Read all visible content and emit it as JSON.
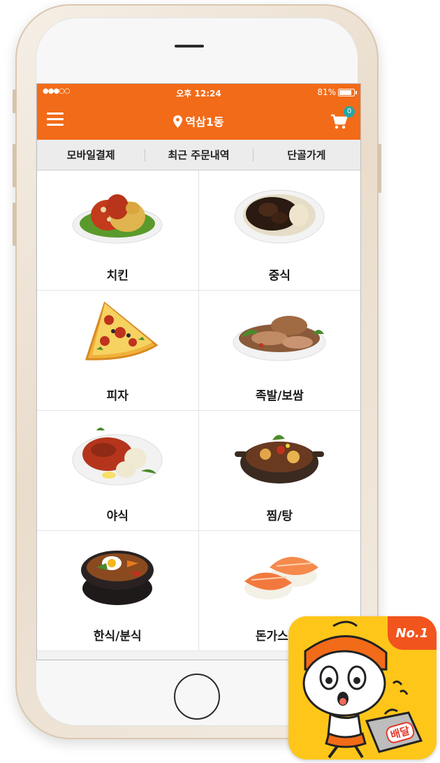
{
  "status": {
    "signal": "●●●○○",
    "time": "오후 12:24",
    "battery": "81%"
  },
  "nav": {
    "location": "역삼1동",
    "cart_count": "0"
  },
  "tabs": [
    {
      "label": "모바일결제"
    },
    {
      "label": "최근 주문내역"
    },
    {
      "label": "단골가게"
    }
  ],
  "categories": [
    {
      "label": "치킨",
      "icon": "chicken-image"
    },
    {
      "label": "중식",
      "icon": "chinese-food-image"
    },
    {
      "label": "피자",
      "icon": "pizza-image"
    },
    {
      "label": "족발/보쌈",
      "icon": "jokbal-bossam-image"
    },
    {
      "label": "야식",
      "icon": "late-night-food-image"
    },
    {
      "label": "찜/탕",
      "icon": "stew-image"
    },
    {
      "label": "한식/분식",
      "icon": "korean-food-image"
    },
    {
      "label": "돈가스/일",
      "icon": "sushi-image"
    }
  ],
  "app_icon": {
    "badge": "No.1",
    "box_text": "배달"
  },
  "colors": {
    "accent": "#f26b18",
    "badge": "#25a5a8",
    "app_bg": "#ffc61a",
    "no1_bg": "#f2541e"
  }
}
